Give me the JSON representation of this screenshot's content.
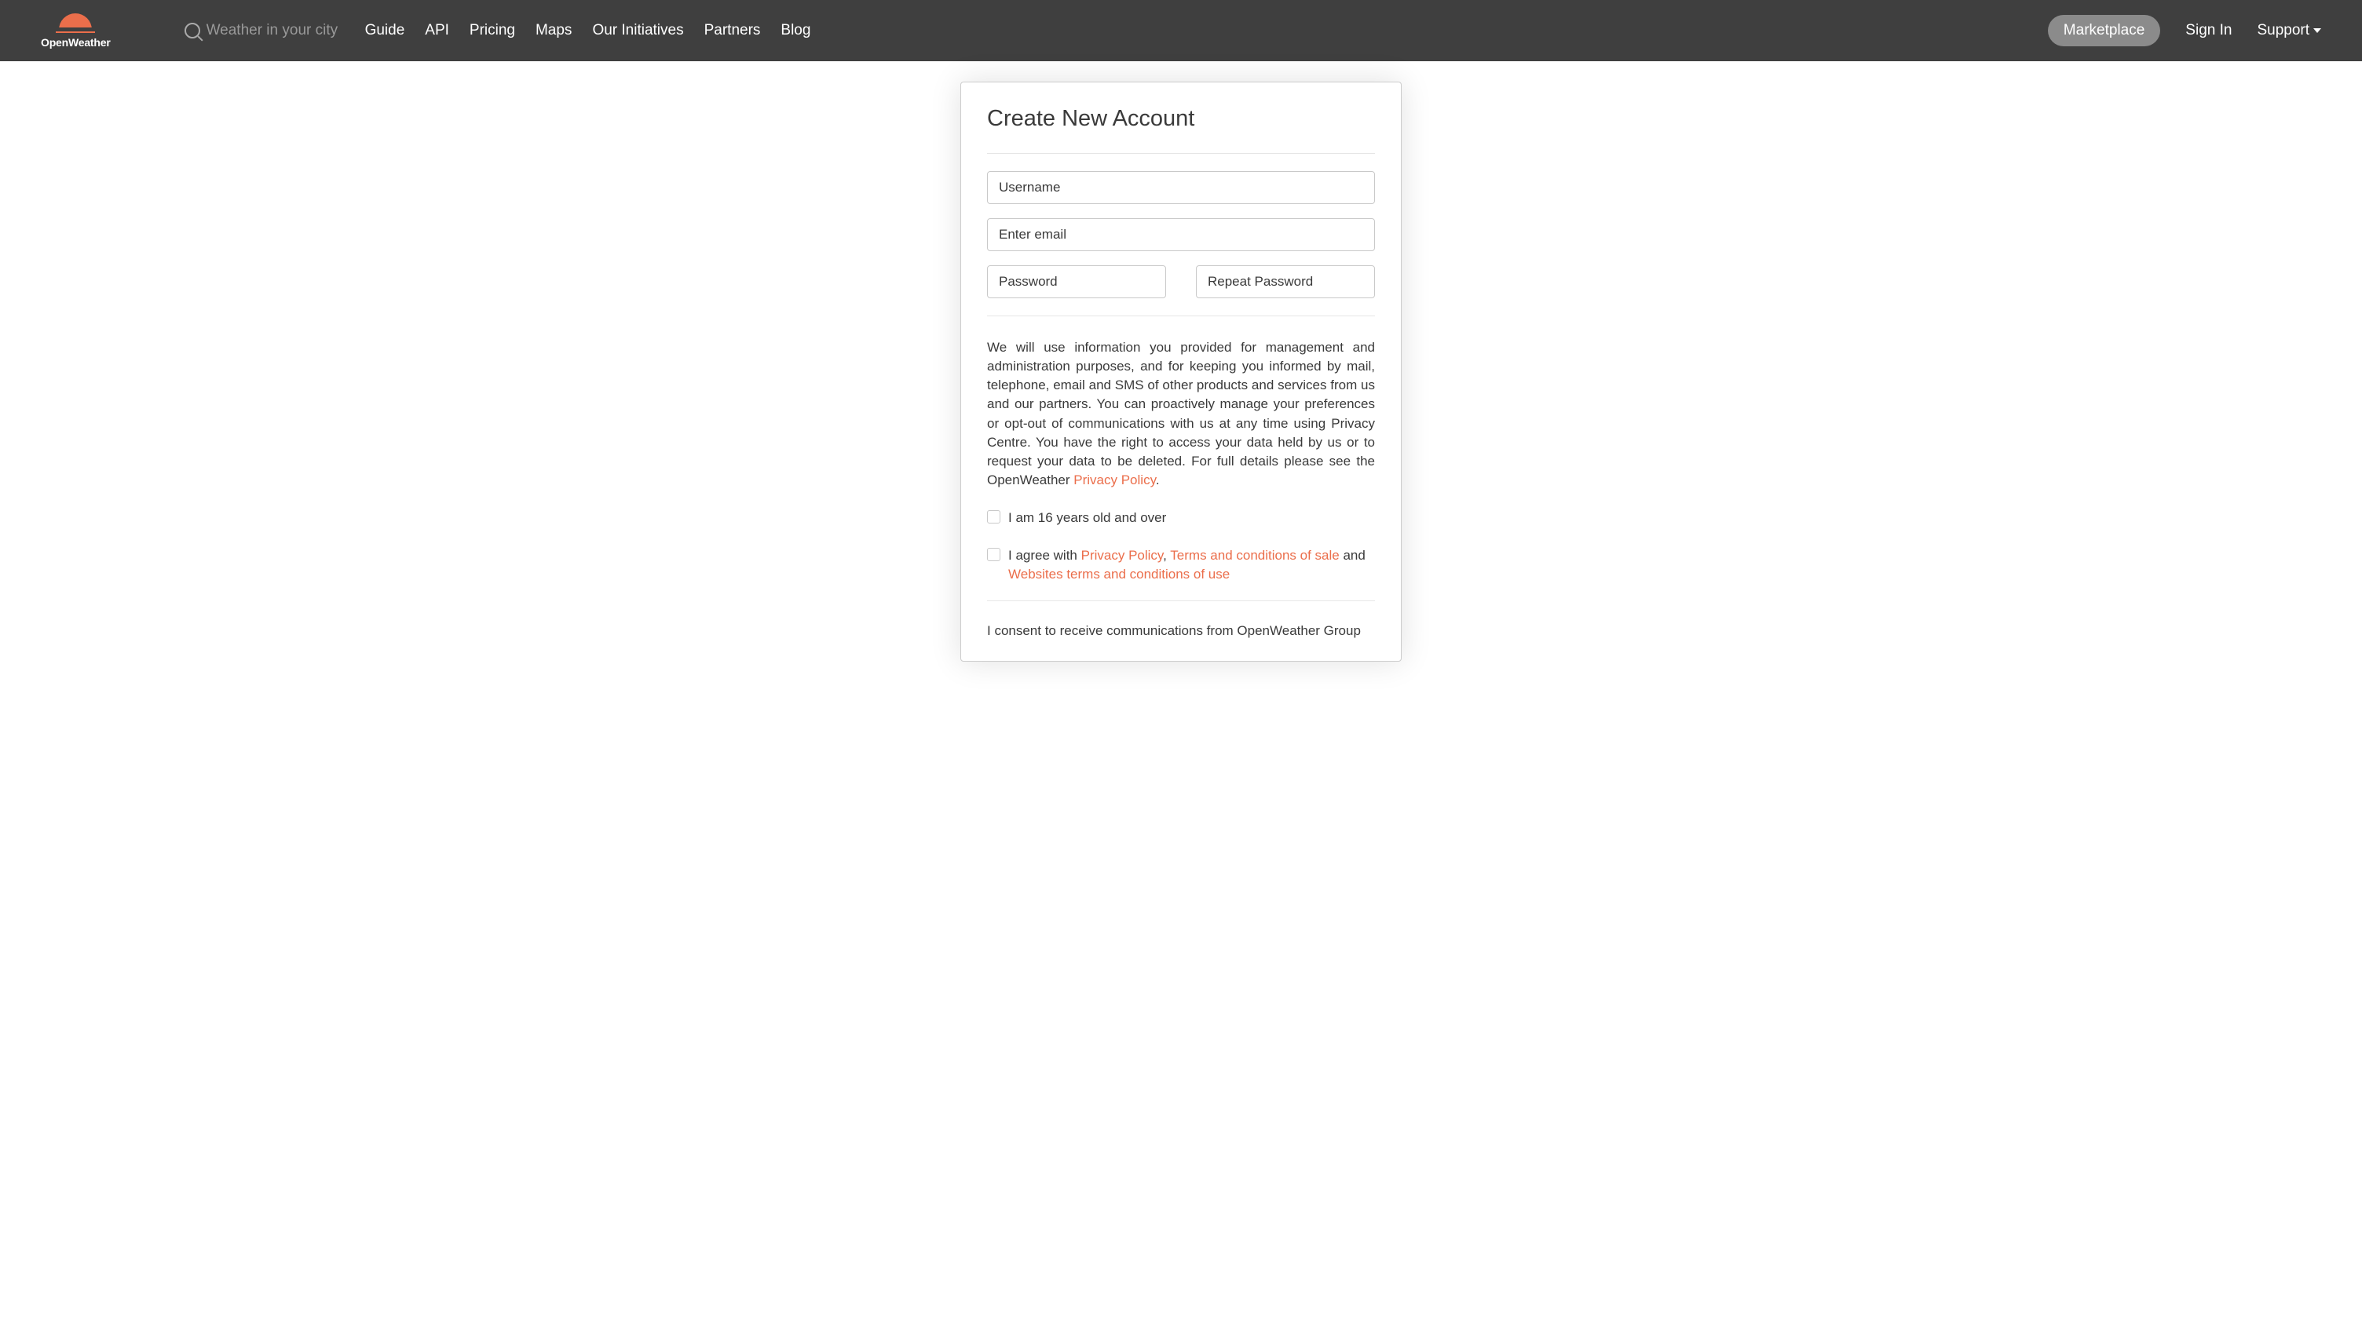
{
  "header": {
    "logo_text": "OpenWeather",
    "search_placeholder": "Weather in your city",
    "nav": [
      "Guide",
      "API",
      "Pricing",
      "Maps",
      "Our Initiatives",
      "Partners",
      "Blog"
    ],
    "pill": "Marketplace",
    "signin": "Sign In",
    "support": "Support"
  },
  "card": {
    "title": "Create New Account",
    "fields": {
      "username": "Username",
      "email": "Enter email",
      "password": "Password",
      "password2": "Repeat Password"
    },
    "info_text": "We will use information you provided for management and administration purposes, and for keeping you informed by mail, telephone, email and SMS of other products and services from us and our partners. You can proactively manage your preferences or opt-out of communications with us at any time using Privacy Centre. You have the right to access your data held by us or to request your data to be deleted. For full details please see the OpenWeather ",
    "info_link": "Privacy Policy",
    "info_period": ".",
    "age_label": "I am 16 years old and over",
    "agree_pre": "I agree with ",
    "agree_l1": "Privacy Policy",
    "agree_c1": ", ",
    "agree_l2": "Terms and conditions of sale",
    "agree_c2": " and ",
    "agree_l3": "Websites terms and conditions of use",
    "consent": "I consent to receive communications from OpenWeather Group"
  }
}
